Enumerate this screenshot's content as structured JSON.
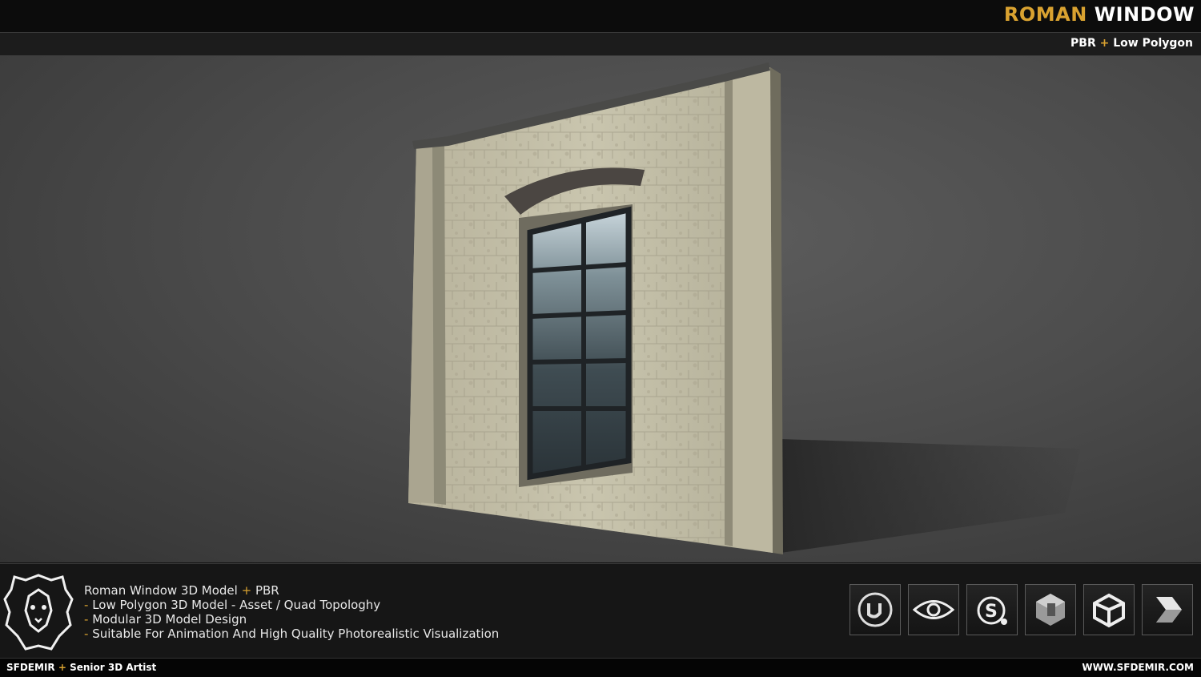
{
  "header": {
    "title_part1": "ROMAN",
    "title_part2": "WINDOW",
    "subtitle_part1": "PBR",
    "subtitle_plus": "+",
    "subtitle_part2": "Low Polygon"
  },
  "description": {
    "line1_main": "Roman Window 3D Model",
    "line1_plus": "+",
    "line1_tail": "PBR",
    "features": [
      {
        "dash": "-",
        "text": "Low Polygon 3D Model - Asset / Quad Topologhy"
      },
      {
        "dash": "-",
        "text": "Modular 3D Model Design"
      },
      {
        "dash": "-",
        "text": "Suitable For Animation And High Quality Photorealistic Visualization"
      }
    ]
  },
  "software_icons": [
    "unreal-engine-icon",
    "marmoset-toolbag-icon",
    "substance-painter-icon",
    "3ds-max-icon",
    "unity-icon",
    "3d-studio-icon"
  ],
  "footer": {
    "credit_name": "SFDEMIR",
    "credit_plus": "+",
    "credit_role": "Senior 3D Artist",
    "website": "WWW.SFDEMIR.COM"
  },
  "colors": {
    "accent": "#d9a230",
    "background": "#111111",
    "scene": "#4c4c4c"
  }
}
